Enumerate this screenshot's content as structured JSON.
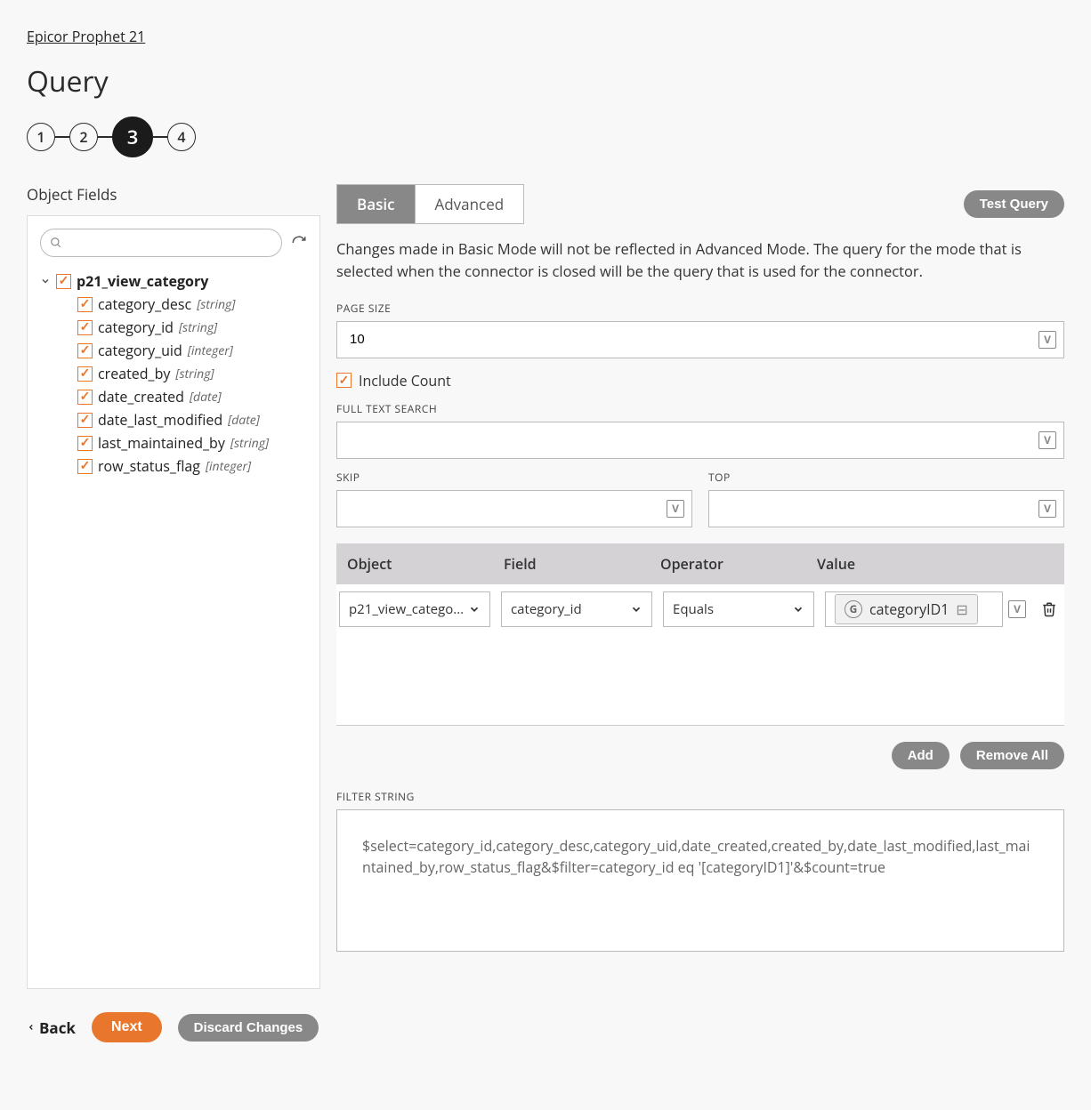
{
  "breadcrumb": "Epicor Prophet 21",
  "page_title": "Query",
  "stepper": {
    "steps": [
      "1",
      "2",
      "3",
      "4"
    ],
    "active_index": 2
  },
  "left": {
    "title": "Object Fields",
    "search_placeholder": "",
    "root": {
      "name": "p21_view_category",
      "checked": true,
      "expanded": true
    },
    "fields": [
      {
        "name": "category_desc",
        "type": "string",
        "checked": true
      },
      {
        "name": "category_id",
        "type": "string",
        "checked": true
      },
      {
        "name": "category_uid",
        "type": "integer",
        "checked": true
      },
      {
        "name": "created_by",
        "type": "string",
        "checked": true
      },
      {
        "name": "date_created",
        "type": "date",
        "checked": true
      },
      {
        "name": "date_last_modified",
        "type": "date",
        "checked": true
      },
      {
        "name": "last_maintained_by",
        "type": "string",
        "checked": true
      },
      {
        "name": "row_status_flag",
        "type": "integer",
        "checked": true
      }
    ]
  },
  "right": {
    "tabs": {
      "basic": "Basic",
      "advanced": "Advanced",
      "active": "basic"
    },
    "test_query": "Test Query",
    "help_text": "Changes made in Basic Mode will not be reflected in Advanced Mode. The query for the mode that is selected when the connector is closed will be the query that is used for the connector.",
    "page_size_label": "PAGE SIZE",
    "page_size_value": "10",
    "include_count_label": "Include Count",
    "include_count_checked": true,
    "full_text_label": "FULL TEXT SEARCH",
    "full_text_value": "",
    "skip_label": "SKIP",
    "skip_value": "",
    "top_label": "TOP",
    "top_value": "",
    "grid": {
      "headers": {
        "object": "Object",
        "field": "Field",
        "operator": "Operator",
        "value": "Value"
      },
      "rows": [
        {
          "object": "p21_view_catego...",
          "field": "category_id",
          "operator": "Equals",
          "value_chip": "categoryID1"
        }
      ]
    },
    "add": "Add",
    "remove_all": "Remove All",
    "filter_string_label": "FILTER STRING",
    "filter_string_value": "$select=category_id,category_desc,category_uid,date_created,created_by,date_last_modified,last_maintained_by,row_status_flag&$filter=category_id eq '[categoryID1]'&$count=true"
  },
  "footer": {
    "back": "Back",
    "next": "Next",
    "discard": "Discard Changes"
  }
}
